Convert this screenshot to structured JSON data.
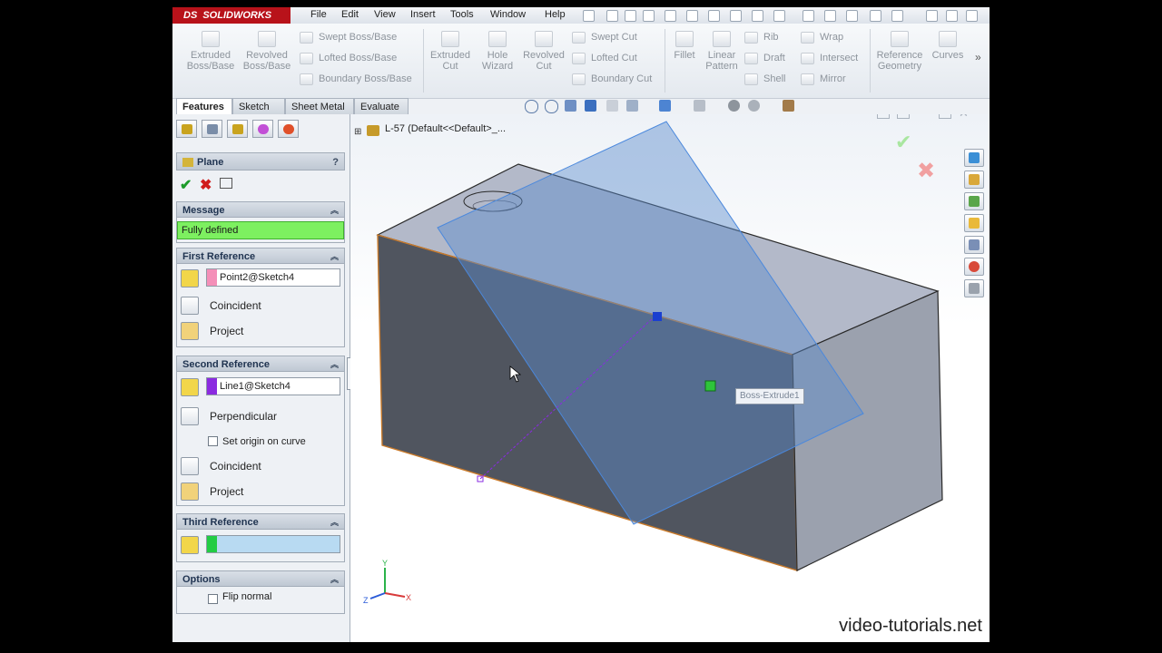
{
  "app": {
    "brand": "SOLIDWORKS",
    "brand_prefix": "DS",
    "menu": [
      "File",
      "Edit",
      "View",
      "Insert",
      "Tools",
      "Window",
      "Help"
    ]
  },
  "command_manager": {
    "tools": [
      {
        "label": "Extruded Boss/Base",
        "icon": "extruded-boss-icon"
      },
      {
        "label": "Revolved Boss/Base",
        "icon": "revolved-boss-icon"
      },
      {
        "label": "Extruded Cut",
        "icon": "extruded-cut-icon"
      },
      {
        "label": "Hole Wizard",
        "icon": "hole-wizard-icon"
      },
      {
        "label": "Revolved Cut",
        "icon": "revolved-cut-icon"
      },
      {
        "label": "Fillet",
        "icon": "fillet-icon"
      },
      {
        "label": "Linear Pattern",
        "icon": "linear-pattern-icon"
      },
      {
        "label": "Reference Geometry",
        "icon": "reference-geometry-icon"
      },
      {
        "label": "Curves",
        "icon": "curves-icon"
      }
    ],
    "small_tools": [
      "Swept Boss/Base",
      "Lofted Boss/Base",
      "Boundary Boss/Base",
      "Swept Cut",
      "Lofted Cut",
      "Boundary Cut",
      "Rib",
      "Draft",
      "Shell",
      "Wrap",
      "Intersect",
      "Mirror"
    ]
  },
  "tabs": [
    "Features",
    "Sketch",
    "Sheet Metal",
    "Evaluate"
  ],
  "feature_tree": {
    "root": "L-57 (Default<<Default>_..."
  },
  "property_manager": {
    "title": "Plane",
    "help": "?",
    "message": {
      "header": "Message",
      "text": "Fully defined",
      "color": "#7df060"
    },
    "first_reference": {
      "header": "First Reference",
      "entity": "Point2@Sketch4",
      "entity_color": "#f48fb8",
      "constraints": [
        "Coincident",
        "Project"
      ]
    },
    "second_reference": {
      "header": "Second Reference",
      "entity": "Line1@Sketch4",
      "entity_color": "#8b2be0",
      "constraints": [
        "Perpendicular",
        "Coincident",
        "Project"
      ],
      "set_origin_label": "Set origin on curve",
      "set_origin_checked": false
    },
    "third_reference": {
      "header": "Third Reference",
      "entity": "",
      "entity_color": "#22cc44"
    },
    "options": {
      "header": "Options",
      "flip_normal_label": "Flip normal",
      "flip_normal_checked": false
    }
  },
  "viewport": {
    "tooltip": "Boss-Extrude1",
    "plane_color": "#5a8ccc",
    "axes": {
      "x": "X",
      "y": "Y",
      "z": "Z"
    }
  },
  "watermark": "video-tutorials.net"
}
